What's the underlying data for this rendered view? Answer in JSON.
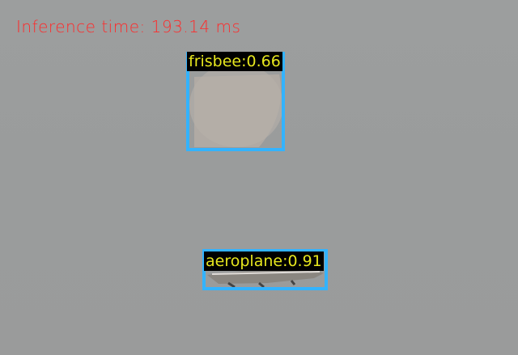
{
  "inference_text": "Inference time: 193.14 ms",
  "colors": {
    "info_text": "#ff2a2a",
    "box": "#33b3ff",
    "label_text": "#e6e61e",
    "label_bg": "#000000",
    "background": "#9b9d9d"
  },
  "detections": [
    {
      "label": "frisbee:0.66",
      "class": "frisbee",
      "score": 0.66
    },
    {
      "label": "aeroplane:0.91",
      "class": "aeroplane",
      "score": 0.91
    }
  ]
}
